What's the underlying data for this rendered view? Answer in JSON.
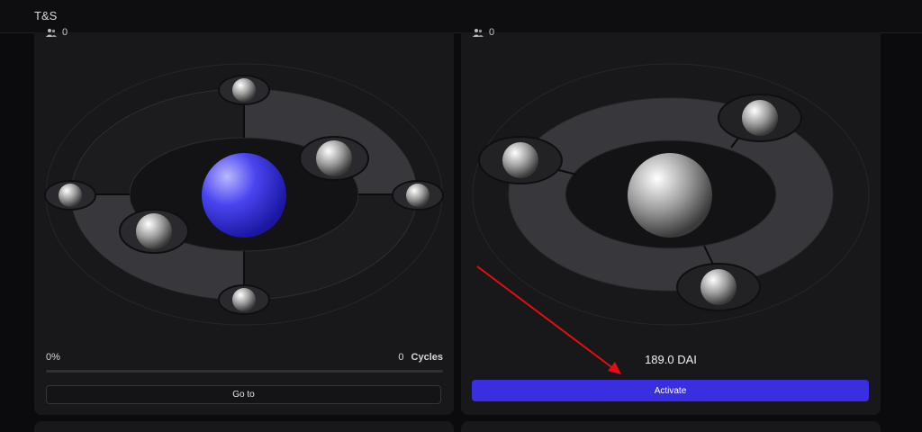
{
  "app": {
    "title": "T&S"
  },
  "cards": [
    {
      "users_count": "0",
      "progress_text": "0%",
      "progress_value": 0,
      "cycles_count": "0",
      "cycles_label": "Cycles",
      "button_label": "Go to",
      "center_color": "#3a36e6"
    },
    {
      "users_count": "0",
      "price": "189.0 DAI",
      "button_label": "Activate",
      "button_color": "#3a2fe0"
    }
  ],
  "colors": {
    "annotation_arrow": "#e01010"
  }
}
